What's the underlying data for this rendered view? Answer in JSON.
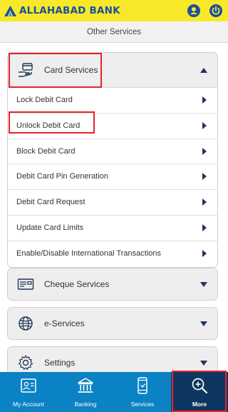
{
  "app": {
    "brand_name": "ALLAHABAD BANK",
    "brand_color": "#1b4f9e",
    "topbar_color": "#f7e92a",
    "icons": {
      "profile": "user-icon",
      "logout": "power-icon"
    }
  },
  "page": {
    "title": "Other Services"
  },
  "sections": {
    "card_services": {
      "label": "Card Services",
      "icon": "card-hand-icon",
      "expanded": true,
      "items": [
        {
          "label": "Lock Debit Card"
        },
        {
          "label": "Unlock Debit Card"
        },
        {
          "label": "Block Debit Card"
        },
        {
          "label": "Debit Card Pin Generation"
        },
        {
          "label": "Debit Card Request"
        },
        {
          "label": "Update Card Limits"
        },
        {
          "label": "Enable/Disable International Transactions"
        }
      ]
    },
    "cheque_services": {
      "label": "Cheque Services",
      "icon": "cheque-icon",
      "expanded": false
    },
    "e_services": {
      "label": "e-Services",
      "icon": "globe-icon",
      "expanded": false
    },
    "settings": {
      "label": "Settings",
      "icon": "gear-icon",
      "expanded": false
    }
  },
  "bottom_nav": {
    "active_color": "#0d3660",
    "bar_color": "#0b82c4",
    "items": [
      {
        "label": "My Account",
        "icon": "account-card-icon"
      },
      {
        "label": "Banking",
        "icon": "bank-icon"
      },
      {
        "label": "Services",
        "icon": "phone-icon"
      },
      {
        "label": "More",
        "icon": "magnify-plus-icon",
        "active": true
      }
    ]
  },
  "highlight_color": "#e8232a"
}
